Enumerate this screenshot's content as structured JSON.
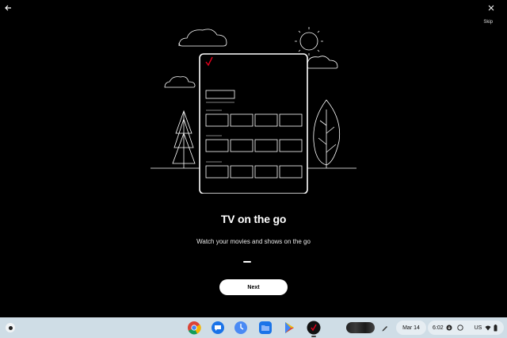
{
  "window": {
    "skip_label": "Skip"
  },
  "onboarding": {
    "title": "TV on the go",
    "subtitle": "Watch your movies and shows on the go",
    "next_label": "Next",
    "page_index": 1,
    "page_count": 1
  },
  "shelf": {
    "apps": [
      {
        "name": "chrome",
        "icon": "chrome-icon"
      },
      {
        "name": "messages",
        "icon": "messages-icon"
      },
      {
        "name": "clock",
        "icon": "clock-icon"
      },
      {
        "name": "files",
        "icon": "files-icon"
      },
      {
        "name": "play-store",
        "icon": "play-store-icon"
      },
      {
        "name": "verizon-tv",
        "icon": "verizon-icon"
      }
    ],
    "date": "Mar 14",
    "time": "6:02",
    "locale": "US"
  },
  "colors": {
    "background": "#000000",
    "accent_check": "#e0001b",
    "shelf": "#cfdde6"
  }
}
